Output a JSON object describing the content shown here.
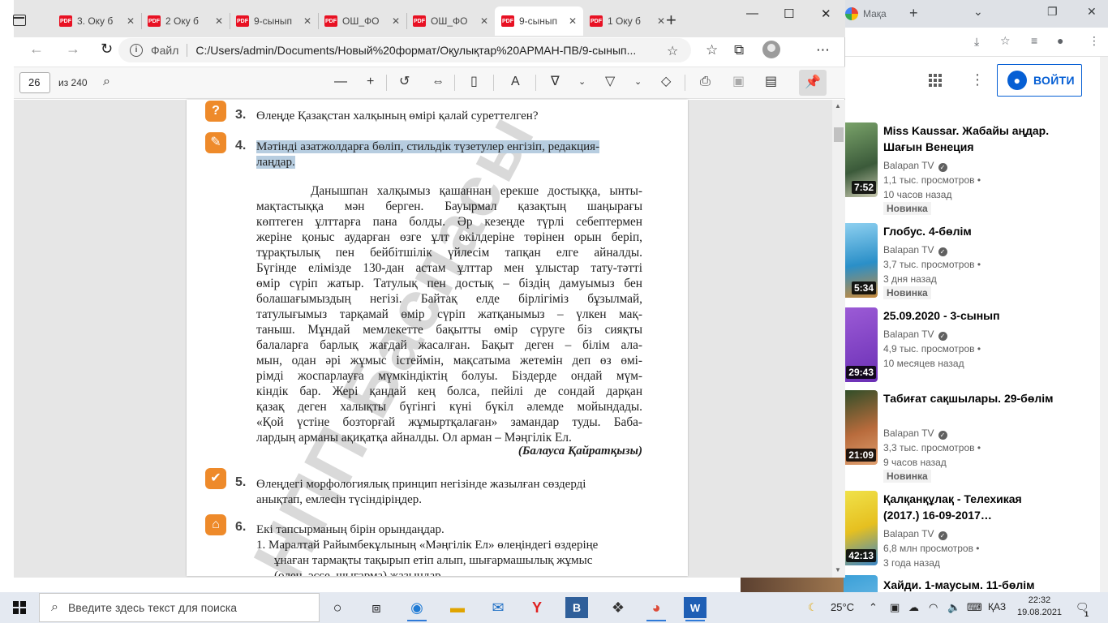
{
  "youtube": {
    "tab_label": "Мақа",
    "signin_label": "ВОЙТИ",
    "videos": [
      {
        "title": "Miss Kaussar. Жабайы аңдар. Шағын Венеция",
        "channel": "Balapan TV",
        "views": "1,1 тыс. просмотров •",
        "age": "10 часов назад",
        "badge": "Новинка",
        "duration": "7:52"
      },
      {
        "title": "Глобус. 4-бөлім",
        "channel": "Balapan TV",
        "views": "3,7 тыс. просмотров •",
        "age": "3 дня назад",
        "badge": "Новинка",
        "duration": "5:34"
      },
      {
        "title": "25.09.2020 - 3-сынып",
        "channel": "Balapan TV",
        "views": "4,9 тыс. просмотров •",
        "age": "10 месяцев назад",
        "badge": "",
        "duration": "29:43"
      },
      {
        "title": "Табиғат сақшылары. 29-бөлім",
        "channel": "Balapan TV",
        "views": "3,3 тыс. просмотров •",
        "age": "9 часов назад",
        "badge": "Новинка",
        "duration": "21:09"
      },
      {
        "title": "Қалқанқұлақ - Телехикая (2017.) 16-09-2017…",
        "channel": "Balapan TV",
        "views": "6,8 млн просмотров •",
        "age": "3 года назад",
        "badge": "",
        "duration": "42:13"
      },
      {
        "title": "Хайди. 1-маусым. 11-бөлім",
        "channel": "",
        "views": "",
        "age": "",
        "badge": "",
        "duration": ""
      }
    ]
  },
  "browser": {
    "tabs": [
      {
        "label": "3. Оку б"
      },
      {
        "label": "2 Оку б"
      },
      {
        "label": "9-сынып"
      },
      {
        "label": "ОШ_ФО"
      },
      {
        "label": "ОШ_ФО"
      },
      {
        "label": "9-сынып"
      },
      {
        "label": "1 Оку б"
      }
    ],
    "file_label": "Файл",
    "url": "C:/Users/admin/Documents/Новый%20формат/Оқулықтар%20АРМАН-ПВ/9-сынып..."
  },
  "pdf": {
    "page_number": "26",
    "page_total": "из 240",
    "questions": [
      {
        "num": "3.",
        "icon": "?",
        "text": "Өлеңде Қазақстан халқының өмірі қалай суреттелген?"
      },
      {
        "num": "4.",
        "icon": "✎",
        "text_line1": "Мәтінді азатжолдарға бөліп, стильдік түзетулер енгізіп, редакция-",
        "text_line2": "лаңдар."
      },
      {
        "num": "5.",
        "icon": "✔",
        "text_line1": "Өлеңдегі морфологиялық принцип негізінде жазылған сөздерді",
        "text_line2": "анықтап, емлесін түсіндіріңдер."
      },
      {
        "num": "6.",
        "icon": "⌂",
        "text_line1": "Екі тапсырманың бірін орындаңдар.",
        "text_line2": "1.  Маралтай Райымбекұлының «Мәңгілік Ел» өлеңіндегі өздеріңе",
        "text_line3": "ұнаған тармақты тақырып етіп алып, шығармашылық жұмыс",
        "text_line4": "(өлең, эссе, шығарма) жазыңдар."
      }
    ],
    "paragraph_lines": [
      "      Данышпан халқымыз қашаннан ерекше достыққа, ынты-",
      "мақтастыққа мән берген. Бауырмал қазақтың шаңырағы",
      "көптеген ұлттарға пана болды. Әр кезеңде түрлі себептермен",
      "жеріне қоныс аударған өзге ұлт өкілдеріне төрінен орын беріп,",
      "тұрақтылық пен бейбітшілік үйлесім тапқан елге айналды.",
      "Бүгінде елімізде 130-дан астам ұлттар мен ұлыстар тату-тәтті",
      "өмір сүріп жатыр. Татулық пен достық – біздің дамуымыз бен",
      "болашағымыздың негізі. Байтақ елде бірлігіміз бұзылмай,",
      "татулығымыз тарқамай өмір сүріп жатқанымыз – үлкен мақ-",
      "таныш. Мұндай мемлекетте бақытты өмір сүруге біз сияқты",
      "балаларға барлық жағдай жасалған. Бақыт деген – білім ала-",
      "мын, одан әрі жұмыс істеймін, мақсатыма жетемін деп өз өмі-",
      "рімді жоспарлауға мүмкіндіктің болуы. Біздерде ондай мүм-",
      "кіндік бар. Жері қандай кең болса, пейілі де сондай дарқан",
      "қазақ деген халықты бүгінгі күні бүкіл әлемде мойындады.",
      "«Қой үстіне бозторғай жұмыртқалаған» замандар туды. Баба-",
      "лардың арманы ақиқатқа айналды. Ол арман – Мәңгілік Ел."
    ],
    "author": "(Балауса Қайратқызы)",
    "watermark": "НПП Баспасы"
  },
  "taskbar": {
    "search_placeholder": "Введите здесь текст для поиска",
    "weather": "25°C",
    "lang": "ҚАЗ",
    "time": "22:32",
    "date": "19.08.2021",
    "notifications": "1"
  }
}
